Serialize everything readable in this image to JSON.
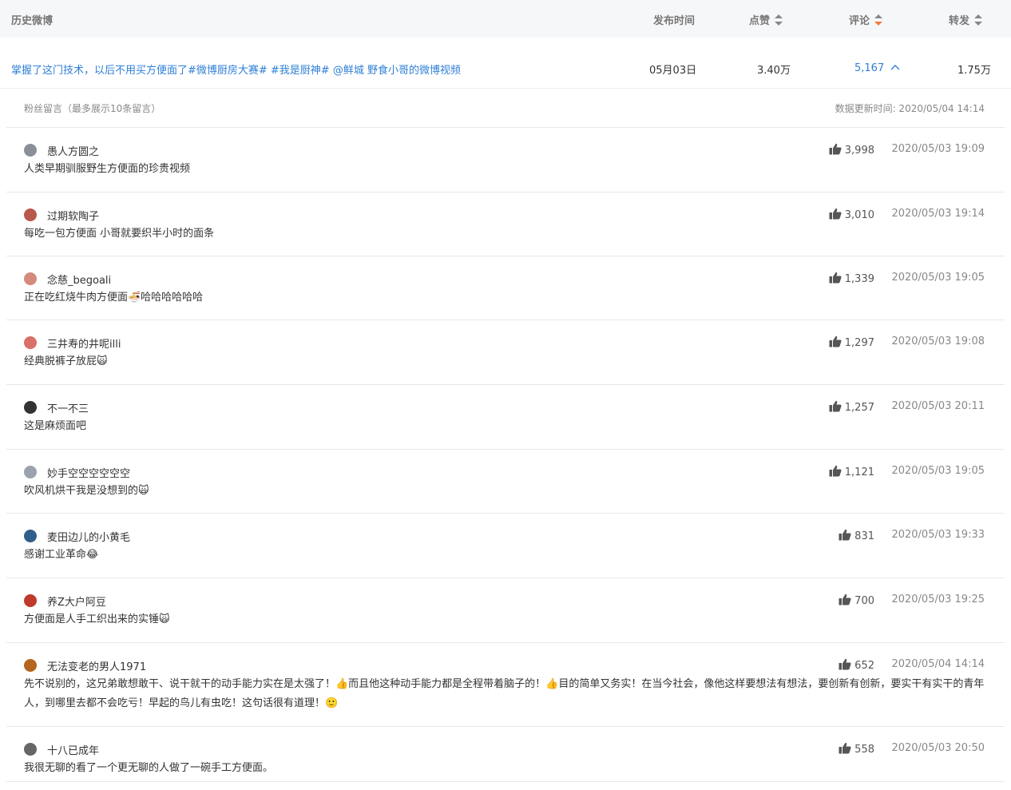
{
  "header": {
    "title": "历史微博",
    "col_time": "发布时间",
    "col_likes": "点赞",
    "col_comments": "评论",
    "col_reposts": "转发"
  },
  "post": {
    "title": "掌握了这门技术，以后不用买方便面了#微博厨房大赛# #我是厨神# @鲜城 野食小哥的微博视频",
    "date": "05月03日",
    "likes": "3.40万",
    "comments": "5,167",
    "reposts": "1.75万"
  },
  "fans": {
    "title": "粉丝留言（最多展示10条留言）",
    "update_time": "数据更新时间: 2020/05/04 14:14"
  },
  "comments": [
    {
      "user": "愚人方圆之",
      "text": "人类早期驯服野生方便面的珍贵视频",
      "likes": "3,998",
      "time": "2020/05/03 19:09",
      "avatar_color": "#8a8f99",
      "emoji": ""
    },
    {
      "user": "过期软陶子",
      "text": "每吃一包方便面 小哥就要织半小时的面条",
      "likes": "3,010",
      "time": "2020/05/03 19:14",
      "avatar_color": "#b9584c",
      "emoji": ""
    },
    {
      "user": "念慈_begoali",
      "text": "正在吃红烧牛肉方便面🍜哈哈哈哈哈哈",
      "likes": "1,339",
      "time": "2020/05/03 19:05",
      "avatar_color": "#d48a7a",
      "emoji": ""
    },
    {
      "user": "三井寿的井呢illi",
      "text": "经典脱裤子放屁🙀",
      "likes": "1,297",
      "time": "2020/05/03 19:08",
      "avatar_color": "#d9706a",
      "emoji": ""
    },
    {
      "user": "不一不三",
      "text": "这是麻烦面吧",
      "likes": "1,257",
      "time": "2020/05/03 20:11",
      "avatar_color": "#333333",
      "emoji": ""
    },
    {
      "user": "妙手空空空空空空",
      "text": "吹风机烘干我是没想到的🙀",
      "likes": "1,121",
      "time": "2020/05/03 19:05",
      "avatar_color": "#9aa3ad",
      "emoji": ""
    },
    {
      "user": "麦田边儿的小黄毛",
      "text": "感谢工业革命😂",
      "likes": "831",
      "time": "2020/05/03 19:33",
      "avatar_color": "#2f5f8a",
      "emoji": ""
    },
    {
      "user": "养Z大户阿豆",
      "text": "方便面是人手工织出来的实锤🙀",
      "likes": "700",
      "time": "2020/05/03 19:25",
      "avatar_color": "#c0392b",
      "emoji": ""
    },
    {
      "user": "无法变老的男人1971",
      "text": "先不说别的，这兄弟敢想敢干、说干就干的动手能力实在是太强了！👍而且他这种动手能力都是全程带着脑子的！👍目的简单又务实！在当今社会，像他这样要想法有想法，要创新有创新，要实干有实干的青年人，到哪里去都不会吃亏！早起的鸟儿有虫吃！这句话很有道理！🙂",
      "likes": "652",
      "time": "2020/05/04 14:14",
      "avatar_color": "#b5651d",
      "emoji": ""
    },
    {
      "user": "十八已成年",
      "text": "我很无聊的看了一个更无聊的人做了一碗手工方便面。",
      "likes": "558",
      "time": "2020/05/03 20:50",
      "avatar_color": "#666666",
      "emoji": ""
    }
  ],
  "colors": {
    "link": "#2f7fd6",
    "sort_active": "#f07c3c",
    "sort_idle": "#888888"
  }
}
